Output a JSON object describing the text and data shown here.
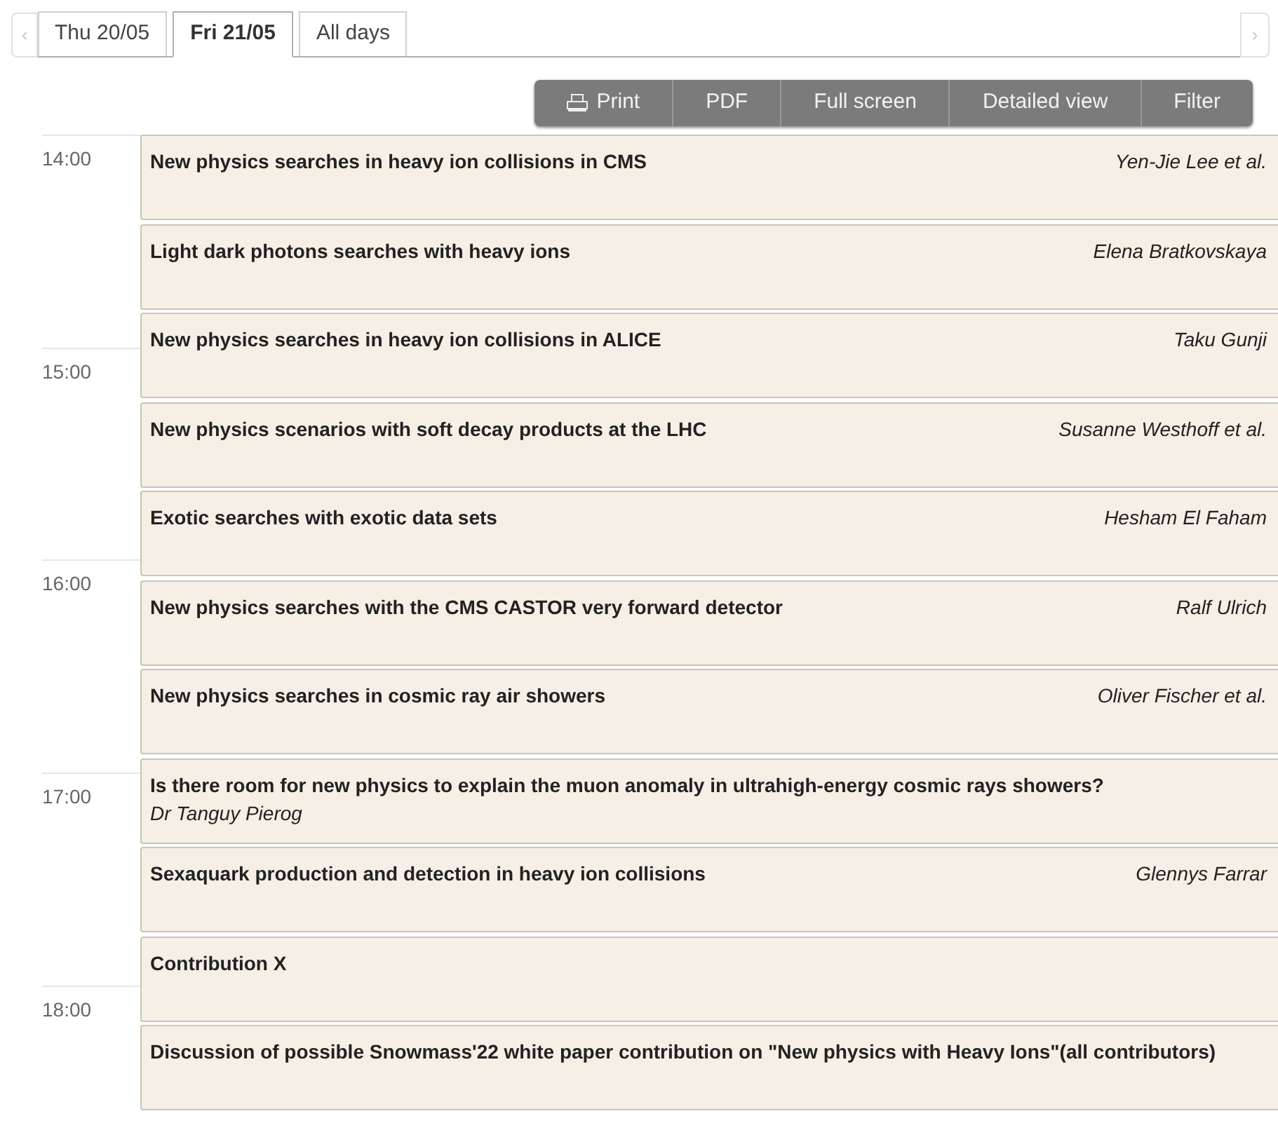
{
  "day_tabs": [
    {
      "label": "Thu 20/05",
      "selected": false
    },
    {
      "label": "Fri 21/05",
      "selected": true
    },
    {
      "label": "All days",
      "selected": false
    }
  ],
  "nav": {
    "prev": "‹",
    "next": "›"
  },
  "toolbar": [
    {
      "label": "Print",
      "kind": "print"
    },
    {
      "label": "PDF",
      "kind": "plain"
    },
    {
      "label": "Full screen",
      "kind": "plain"
    },
    {
      "label": "Detailed view",
      "kind": "plain"
    },
    {
      "label": "Filter",
      "kind": "plain"
    }
  ],
  "hours": [
    "14:00",
    "15:00",
    "16:00",
    "17:00",
    "18:00"
  ],
  "entries": [
    {
      "title": "New physics searches in heavy ion collisions in CMS",
      "speaker": "Yen-Jie Lee et al.",
      "kind": "inline"
    },
    {
      "title": "Light dark photons searches with heavy ions",
      "speaker": "Elena Bratkovskaya",
      "kind": "inline"
    },
    {
      "title": "New physics searches in heavy ion collisions in ALICE",
      "speaker": "Taku Gunji",
      "kind": "inline"
    },
    {
      "title": "New physics scenarios with soft decay products at the LHC",
      "speaker": "Susanne Westhoff et al.",
      "kind": "inline"
    },
    {
      "title": "Exotic searches with exotic data sets",
      "speaker": "Hesham El Faham",
      "kind": "inline"
    },
    {
      "title": "New physics searches with the CMS CASTOR very forward detector",
      "speaker": "Ralf Ulrich",
      "kind": "inline"
    },
    {
      "title": "New physics searches in cosmic ray air showers",
      "speaker": "Oliver Fischer et al.",
      "kind": "inline"
    },
    {
      "title": "Is there room for new physics to explain the muon anomaly in ultrahigh-energy cosmic rays showers?",
      "speaker": "Dr Tanguy Pierog",
      "kind": "below"
    },
    {
      "title": "Sexaquark production and detection in heavy ion collisions",
      "speaker": "Glennys Farrar",
      "kind": "inline"
    },
    {
      "title": "Contribution X",
      "kind": "inline"
    },
    {
      "title": "Discussion of possible Snowmass'22 white paper contribution on \"New physics with Heavy Ions\"(all contributors)",
      "kind": "inline"
    }
  ]
}
